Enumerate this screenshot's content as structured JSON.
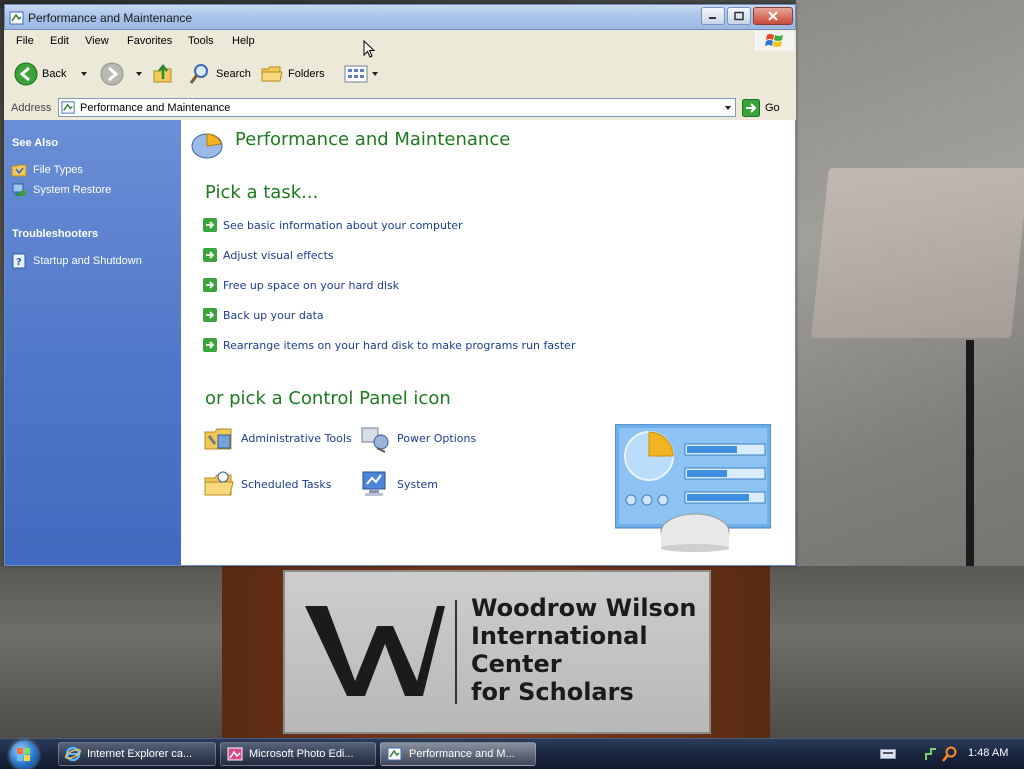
{
  "window": {
    "title": "Performance and Maintenance"
  },
  "menu": {
    "items": [
      "File",
      "Edit",
      "View",
      "Favorites",
      "Tools",
      "Help"
    ]
  },
  "toolbar": {
    "back_label": "Back",
    "search_label": "Search",
    "folders_label": "Folders"
  },
  "address": {
    "label": "Address",
    "value": "Performance and Maintenance",
    "go_label": "Go"
  },
  "sidebar": {
    "see_also_title": "See Also",
    "see_also": [
      "File Types",
      "System Restore"
    ],
    "troubleshooters_title": "Troubleshooters",
    "troubleshooters": [
      "Startup and Shutdown"
    ]
  },
  "main": {
    "title": "Performance and Maintenance",
    "pick_task_heading": "Pick a task...",
    "tasks": [
      "See basic information about your computer",
      "Adjust visual effects",
      "Free up space on your hard disk",
      "Back up your data",
      "Rearrange items on your hard disk to make programs run faster"
    ],
    "pick_icon_heading": "or pick a Control Panel icon",
    "icons": [
      "Administrative Tools",
      "Power Options",
      "Scheduled Tasks",
      "System"
    ]
  },
  "wallpaper": {
    "plaque_lines": [
      "Woodrow Wilson",
      "International",
      "Center",
      "for Scholars"
    ]
  },
  "taskbar": {
    "buttons": [
      "Internet Explorer ca...",
      "Microsoft Photo Edi...",
      "Performance and M..."
    ],
    "active_index": 2,
    "clock": "1:48 AM"
  },
  "colors": {
    "heading_green": "#1e7a1e",
    "link_blue": "#1d3d8c",
    "sidebar_blue": "#4f77c9"
  }
}
